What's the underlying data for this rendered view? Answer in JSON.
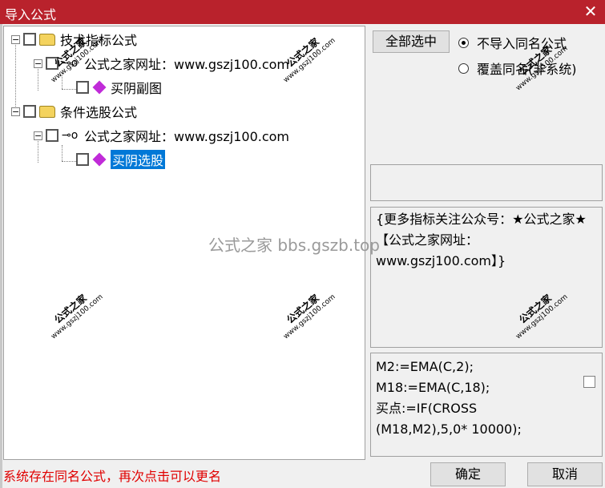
{
  "window": {
    "title": "导入公式",
    "close_glyph": "✕"
  },
  "tree": {
    "group1": {
      "label": "技术指标公式",
      "collapse_glyph": "−"
    },
    "group1_site": {
      "label": "公式之家网址：www.gszj100.com",
      "collapse_glyph": "−"
    },
    "group1_item": {
      "label": "买阴副图"
    },
    "group2": {
      "label": "条件选股公式",
      "collapse_glyph": "−"
    },
    "group2_site": {
      "label": "公式之家网址：www.gszj100.com",
      "collapse_glyph": "−"
    },
    "group2_item": {
      "label": "买阴选股"
    },
    "key_glyph": "⊸o"
  },
  "options": {
    "select_all": "全部选中",
    "radio_no_import": "不导入同名公式",
    "radio_overwrite": "覆盖同名(非系统)"
  },
  "description": "{更多指标关注公众号：★公式之家★【公式之家网址：www.gszj100.com】}",
  "code_lines": [
    "M2:=EMA(C,2);",
    "M18:=EMA(C,18);",
    "买点:=IF(CROSS",
    "(M18,M2),5,0* 10000);"
  ],
  "status": "系统存在同名公式，再次点击可以更名",
  "buttons": {
    "ok": "确定",
    "cancel": "取消"
  },
  "watermark": {
    "text": "公式之家",
    "url": "www.gszj100.com",
    "center": "公式之家 bbs.gszb.top"
  }
}
